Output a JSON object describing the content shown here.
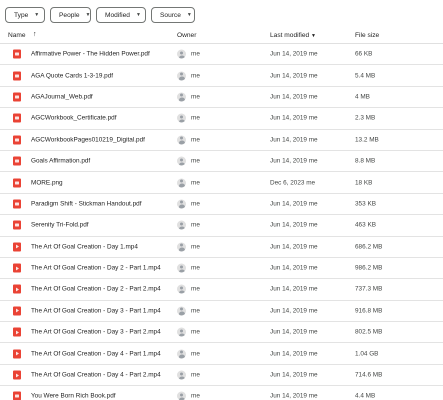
{
  "filters": [
    {
      "label": "Type"
    },
    {
      "label": "People"
    },
    {
      "label": "Modified"
    },
    {
      "label": "Source"
    }
  ],
  "columns": {
    "name": "Name",
    "owner": "Owner",
    "modified": "Last modified",
    "size": "File size"
  },
  "files": [
    {
      "name": "Affirmative Power - The Hidden Power.pdf",
      "type": "pdf",
      "owner": "me",
      "modified": "Jun 14, 2019 me",
      "size": "66 KB"
    },
    {
      "name": "AGA Quote Cards 1-3-19.pdf",
      "type": "pdf",
      "owner": "me",
      "modified": "Jun 14, 2019 me",
      "size": "5.4 MB"
    },
    {
      "name": "AGAJournal_Web.pdf",
      "type": "pdf",
      "owner": "me",
      "modified": "Jun 14, 2019 me",
      "size": "4 MB"
    },
    {
      "name": "AGCWorkbook_Certificate.pdf",
      "type": "pdf",
      "owner": "me",
      "modified": "Jun 14, 2019 me",
      "size": "2.3 MB"
    },
    {
      "name": "AGCWorkbookPages010219_Digital.pdf",
      "type": "pdf",
      "owner": "me",
      "modified": "Jun 14, 2019 me",
      "size": "13.2 MB"
    },
    {
      "name": "Goals Affirmation.pdf",
      "type": "pdf",
      "owner": "me",
      "modified": "Jun 14, 2019 me",
      "size": "8.8 MB"
    },
    {
      "name": "MORE.png",
      "type": "png",
      "owner": "me",
      "modified": "Dec 6, 2023 me",
      "size": "18 KB"
    },
    {
      "name": "Paradigm Shift - Stickman Handout.pdf",
      "type": "pdf",
      "owner": "me",
      "modified": "Jun 14, 2019 me",
      "size": "353 KB"
    },
    {
      "name": "Serenity Tri-Fold.pdf",
      "type": "pdf",
      "owner": "me",
      "modified": "Jun 14, 2019 me",
      "size": "463 KB"
    },
    {
      "name": "The Art Of Goal Creation - Day 1.mp4",
      "type": "mp4",
      "owner": "me",
      "modified": "Jun 14, 2019 me",
      "size": "686.2 MB"
    },
    {
      "name": "The Art Of Goal Creation - Day 2 - Part 1.mp4",
      "type": "mp4",
      "owner": "me",
      "modified": "Jun 14, 2019 me",
      "size": "986.2 MB"
    },
    {
      "name": "The Art Of Goal Creation - Day 2 - Part 2.mp4",
      "type": "mp4",
      "owner": "me",
      "modified": "Jun 14, 2019 me",
      "size": "737.3 MB"
    },
    {
      "name": "The Art Of Goal Creation - Day 3 - Part 1.mp4",
      "type": "mp4",
      "owner": "me",
      "modified": "Jun 14, 2019 me",
      "size": "916.8 MB"
    },
    {
      "name": "The Art Of Goal Creation - Day 3 - Part 2.mp4",
      "type": "mp4",
      "owner": "me",
      "modified": "Jun 14, 2019 me",
      "size": "802.5 MB"
    },
    {
      "name": "The Art Of Goal Creation - Day 4 - Part 1.mp4",
      "type": "mp4",
      "owner": "me",
      "modified": "Jun 14, 2019 me",
      "size": "1.04 GB"
    },
    {
      "name": "The Art Of Goal Creation - Day 4 - Part 2.mp4",
      "type": "mp4",
      "owner": "me",
      "modified": "Jun 14, 2019 me",
      "size": "714.6 MB"
    },
    {
      "name": "You Were Born Rich Book.pdf",
      "type": "pdf",
      "owner": "me",
      "modified": "Jun 14, 2019 me",
      "size": "4.4 MB"
    }
  ]
}
